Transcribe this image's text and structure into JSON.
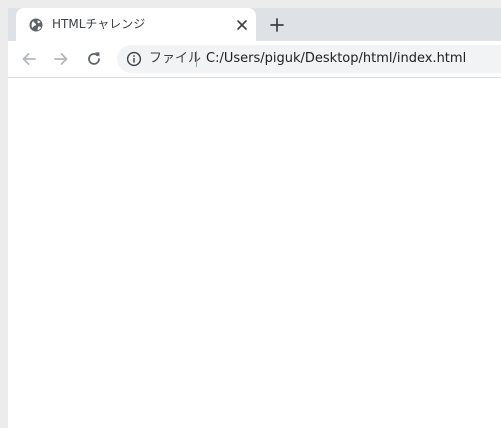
{
  "tab": {
    "title": "HTMLチャレンジ",
    "favicon": "globe-icon",
    "close_icon": "close-icon"
  },
  "new_tab_icon": "plus-icon",
  "toolbar": {
    "back_icon": "arrow-left-icon",
    "forward_icon": "arrow-right-icon",
    "reload_icon": "reload-icon"
  },
  "omnibox": {
    "info_icon": "info-icon",
    "scheme_label": "ファイル",
    "url": "C:/Users/piguk/Desktop/html/index.html"
  },
  "colors": {
    "tabstrip": "#dee1e6",
    "tab_active": "#ffffff",
    "omnibox": "#f1f3f4",
    "text": "#202124",
    "icon": "#5f6368",
    "icon_disabled": "#b4b8bc"
  }
}
